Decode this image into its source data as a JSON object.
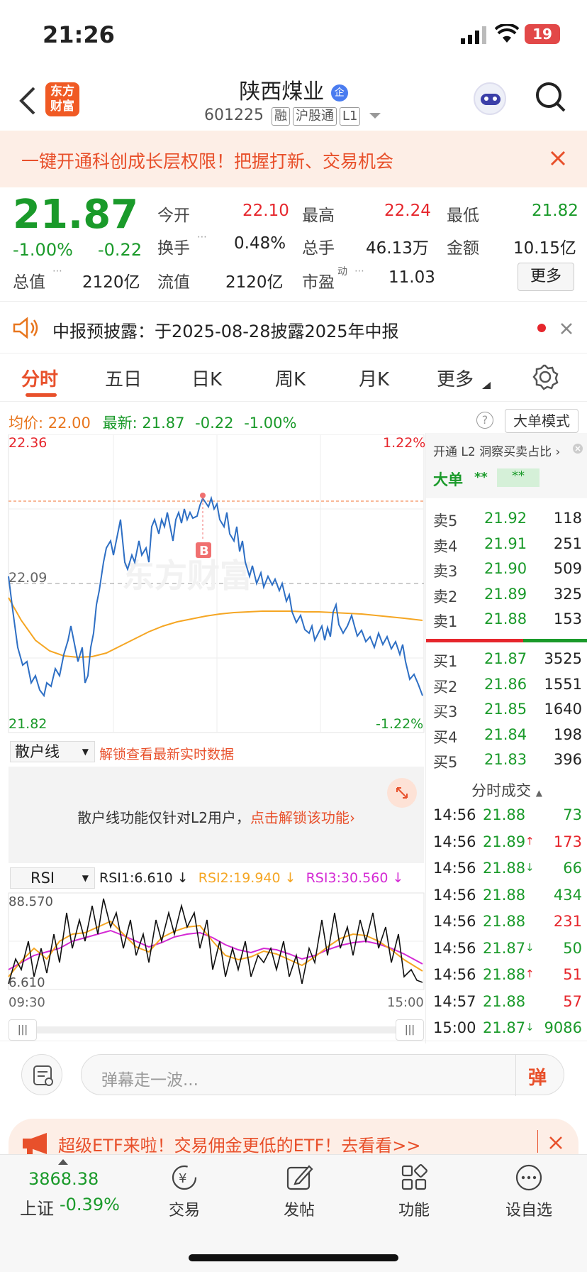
{
  "status": {
    "time": "21:26",
    "battery": "19"
  },
  "header": {
    "logo_line1": "东方",
    "logo_line2": "财富",
    "title": "陕西煤业",
    "title_badge": "企",
    "code": "601225",
    "tags": [
      "融",
      "沪股通",
      "L1"
    ]
  },
  "banner": {
    "text": "一键开通科创成长层权限！把握打新、交易机会"
  },
  "quote": {
    "price": "21.87",
    "pct": "-1.00%",
    "chg": "-0.22",
    "fields": [
      {
        "label": "今开",
        "value": "22.10"
      },
      {
        "label": "最高",
        "value": "22.24"
      },
      {
        "label": "最低",
        "value": "21.82"
      },
      {
        "label": "换手",
        "value": "0.48%"
      },
      {
        "label": "总手",
        "value": "46.13万"
      },
      {
        "label": "金额",
        "value": "10.15亿"
      },
      {
        "label": "总值",
        "value": "2120亿"
      },
      {
        "label": "流值",
        "value": "2120亿"
      },
      {
        "label": "市盈",
        "label_sup": "动",
        "value": "11.03"
      }
    ],
    "more": "更多"
  },
  "notice": {
    "text": "中报预披露：于2025-08-28披露2025年中报"
  },
  "tabs": [
    "分时",
    "五日",
    "日K",
    "周K",
    "月K",
    "更多"
  ],
  "chart": {
    "avg_label": "均价:",
    "avg_value": "22.00",
    "latest_label": "最新:",
    "latest_value": "21.87",
    "latest_chg": "-0.22",
    "latest_pct": "-1.00%",
    "big_order_mode": "大单模式",
    "y_high": "22.36",
    "y_mid": "22.09",
    "y_low": "21.82",
    "pct_high": "1.22%",
    "pct_low": "-1.22%",
    "marker": "B",
    "watermark": "东方财富",
    "retail_select": "散户线",
    "retail_link": "解锁查看最新实时数据",
    "retail_msg": "散户线功能仅针对L2用户，",
    "retail_msg_link": "点击解锁该功能",
    "rsi_select": "RSI",
    "rsi1": "RSI1:6.610 ↓",
    "rsi2": "RSI2:19.940 ↓",
    "rsi3": "RSI3:30.560 ↓",
    "rsi_high": "88.570",
    "rsi_low": "6.610",
    "time_start": "09:30",
    "time_end": "15:00"
  },
  "depth": {
    "l2_label": "开通 L2 洞察买卖占比 ›",
    "big_label": "大单",
    "stars1": "**",
    "stars2": "**",
    "asks": [
      {
        "name": "卖5",
        "price": "21.92",
        "vol": "118"
      },
      {
        "name": "卖4",
        "price": "21.91",
        "vol": "251"
      },
      {
        "name": "卖3",
        "price": "21.90",
        "vol": "509"
      },
      {
        "name": "卖2",
        "price": "21.89",
        "vol": "325"
      },
      {
        "name": "卖1",
        "price": "21.88",
        "vol": "153"
      }
    ],
    "bids": [
      {
        "name": "买1",
        "price": "21.87",
        "vol": "3525"
      },
      {
        "name": "买2",
        "price": "21.86",
        "vol": "1551"
      },
      {
        "name": "买3",
        "price": "21.85",
        "vol": "1640"
      },
      {
        "name": "买4",
        "price": "21.84",
        "vol": "198"
      },
      {
        "name": "买5",
        "price": "21.83",
        "vol": "396"
      }
    ],
    "trades_title": "分时成交",
    "trades": [
      {
        "t": "14:56",
        "p": "21.88",
        "arrow": "",
        "v": "73",
        "vc": "green"
      },
      {
        "t": "14:56",
        "p": "21.89",
        "arrow": "↑",
        "v": "173",
        "vc": "red"
      },
      {
        "t": "14:56",
        "p": "21.88",
        "arrow": "↓",
        "v": "66",
        "vc": "green"
      },
      {
        "t": "14:56",
        "p": "21.88",
        "arrow": "",
        "v": "434",
        "vc": "green"
      },
      {
        "t": "14:56",
        "p": "21.88",
        "arrow": "",
        "v": "231",
        "vc": "red"
      },
      {
        "t": "14:56",
        "p": "21.87",
        "arrow": "↓",
        "v": "50",
        "vc": "green"
      },
      {
        "t": "14:56",
        "p": "21.88",
        "arrow": "↑",
        "v": "51",
        "vc": "red"
      },
      {
        "t": "14:57",
        "p": "21.88",
        "arrow": "",
        "v": "57",
        "vc": "red"
      },
      {
        "t": "15:00",
        "p": "21.87",
        "arrow": "↓",
        "v": "9086",
        "vc": "green"
      }
    ]
  },
  "danmu": {
    "placeholder": "弹幕走一波...",
    "btn": "弹"
  },
  "ad": {
    "text": "超级ETF来啦！交易佣金更低的ETF！去看看>>"
  },
  "bottom": {
    "index_value": "3868.38",
    "index_name": "上证",
    "index_pct": "-0.39%",
    "items": [
      "交易",
      "发帖",
      "功能",
      "设自选"
    ]
  }
}
